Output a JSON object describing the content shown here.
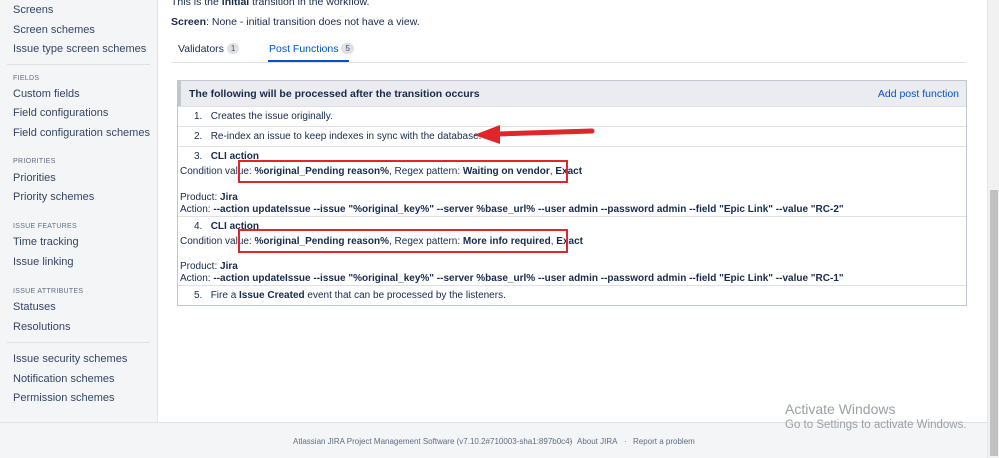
{
  "sidebar": {
    "links_top": [
      "Screens",
      "Screen schemes",
      "Issue type screen schemes"
    ],
    "fields": {
      "heading": "FIELDS",
      "items": [
        "Custom fields",
        "Field configurations",
        "Field configuration schemes"
      ]
    },
    "priorities": {
      "heading": "PRIORITIES",
      "items": [
        "Priorities",
        "Priority schemes"
      ]
    },
    "issue_features": {
      "heading": "ISSUE FEATURES",
      "items": [
        "Time tracking",
        "Issue linking"
      ]
    },
    "issue_attributes": {
      "heading": "ISSUE ATTRIBUTES",
      "items": [
        "Statuses",
        "Resolutions"
      ]
    },
    "links_bottom": [
      "Issue security schemes",
      "Notification schemes",
      "Permission schemes"
    ]
  },
  "main": {
    "intro": {
      "prefix": "This is the ",
      "bold": "initial",
      "suffix": " transition in the workflow."
    },
    "screen": {
      "label": "Screen",
      "text": ": None - initial transition does not have a view."
    },
    "tabs": [
      {
        "label": "Validators",
        "count": "1"
      },
      {
        "label": "Post Functions",
        "count": "5"
      }
    ],
    "panel": {
      "title": "The following will be processed after the transition occurs",
      "add_link": "Add post function",
      "steps": [
        "Creates the issue originally.",
        "Re-index an issue to keep indexes in sync with the database."
      ],
      "cli_actions": [
        {
          "num": "3.",
          "title": "CLI action",
          "cond_label": "Condition value: ",
          "cond_value": "%original_Pending reason%",
          "regex_label": ", Regex pattern: ",
          "regex_value": "Waiting on vendor",
          "sep": ", ",
          "exact": "Exact",
          "product_label": "Product: ",
          "product": "Jira",
          "action_label": "Action: ",
          "action": "--action updateIssue --issue \"%original_key%\" --server %base_url% --user admin --password admin --field \"Epic Link\" --value \"RC-2\""
        },
        {
          "num": "4.",
          "title": "CLI action",
          "cond_label": "Condition value: ",
          "cond_value": "%original_Pending reason%",
          "regex_label": ", Regex pattern: ",
          "regex_value": "More info required",
          "sep": ", ",
          "exact": "Exact",
          "product_label": "Product: ",
          "product": "Jira",
          "action_label": "Action: ",
          "action": "--action updateIssue --issue \"%original_key%\" --server %base_url% --user admin --password admin --field \"Epic Link\" --value \"RC-1\""
        }
      ],
      "final_step": {
        "num": "5.",
        "prefix": "Fire a ",
        "bold": "Issue Created",
        "suffix": " event that can be processed by the listeners."
      }
    }
  },
  "footer": {
    "software": "Atlassian JIRA Project Management Software (v7.10.2#710003-sha1:897b0c4)",
    "dot": "·",
    "about": "About JIRA",
    "report": "Report a problem"
  },
  "watermark": {
    "title": "Activate Windows",
    "subtitle": "Go to Settings to activate Windows."
  },
  "colors": {
    "link": "#0052cc",
    "highlight": "#e0262b",
    "text": "#172b4d"
  }
}
